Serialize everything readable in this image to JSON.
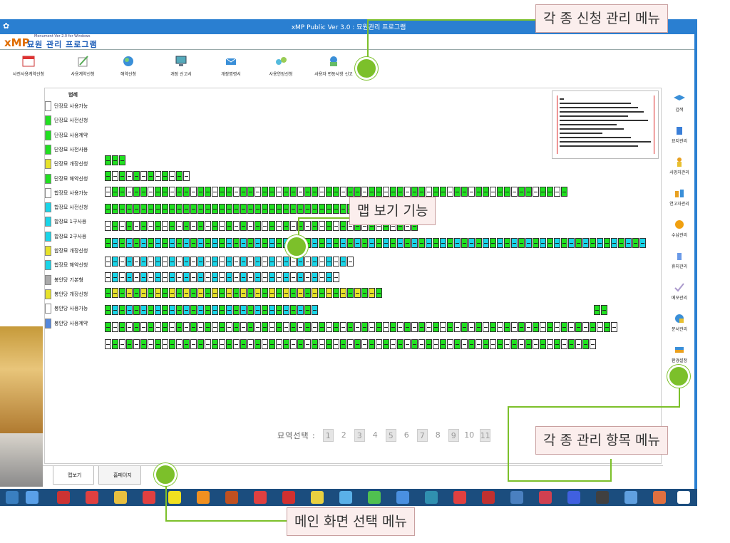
{
  "window": {
    "title": "xMP Public Ver 3.0 : 묘원관리 프로그램"
  },
  "logo": {
    "brand": "xMP",
    "korean": "묘원 관리 프로그램",
    "small": "Monument Ver 2.0 for Windows"
  },
  "toolbar": {
    "items": [
      {
        "label": "사전사용계약신청"
      },
      {
        "label": "사용계약신청"
      },
      {
        "label": "해약신청"
      },
      {
        "label": "개장 신고서"
      },
      {
        "label": "개장명령서"
      },
      {
        "label": "사용연장신청"
      },
      {
        "label": "사용자 변동사항 신고"
      }
    ]
  },
  "legend": {
    "title": "범례",
    "items": [
      {
        "label": "단장묘 사용가능",
        "color": "#ffffff"
      },
      {
        "label": "단장묘 사전신청",
        "color": "#20e020"
      },
      {
        "label": "단장묘 사용계약",
        "color": "#20e020"
      },
      {
        "label": "단장묘 사전사용",
        "color": "#20e020"
      },
      {
        "label": "단장묘 개장신청",
        "color": "#e6e22a"
      },
      {
        "label": "단장묘 해약신청",
        "color": "#20e020"
      },
      {
        "label": "합장묘 사용가능",
        "color": "#ffffff"
      },
      {
        "label": "합장묘 사전신청",
        "color": "#19d5e8"
      },
      {
        "label": "합장묘 1구사용",
        "color": "#19d5e8"
      },
      {
        "label": "합장묘 2구사용",
        "color": "#19d5e8"
      },
      {
        "label": "합장묘 개장신청",
        "color": "#e6e22a"
      },
      {
        "label": "합장묘 해약신청",
        "color": "#19d5e8"
      },
      {
        "label": "봉안당 기본형",
        "color": "#aaaaaa"
      },
      {
        "label": "봉안당 개장신청",
        "color": "#e6e22a"
      },
      {
        "label": "봉안당 사용가능",
        "color": "#ffffff"
      },
      {
        "label": "봉안당 사용계약",
        "color": "#5588dd"
      }
    ]
  },
  "pager": {
    "label": "묘역선택 :",
    "pages": [
      "1",
      "2",
      "3",
      "4",
      "5",
      "6",
      "7",
      "8",
      "9",
      "10",
      "11"
    ]
  },
  "right_menu": {
    "items": [
      {
        "label": "검색"
      },
      {
        "label": "묘지관리"
      },
      {
        "label": "사망자관리"
      },
      {
        "label": "연고자관리"
      },
      {
        "label": "수납관리"
      },
      {
        "label": "휴지관리"
      },
      {
        "label": "메모관리"
      },
      {
        "label": "문서관리"
      },
      {
        "label": "환경설정"
      },
      {
        "label": "종료"
      }
    ]
  },
  "tabs": [
    {
      "label": "맵보기"
    },
    {
      "label": "홈페이지"
    }
  ],
  "callouts": {
    "request_menu": "각 종 신청 관리 메뉴",
    "map_view": "맵 보기 기능",
    "manage_menu": "각 종 관리 항목 메뉴",
    "main_select": "메인 화면 선택 메뉴"
  },
  "colors": {
    "accent": "#7cc02a",
    "titlebar": "#2a7fd1",
    "callout_bg": "#fbeeed"
  }
}
